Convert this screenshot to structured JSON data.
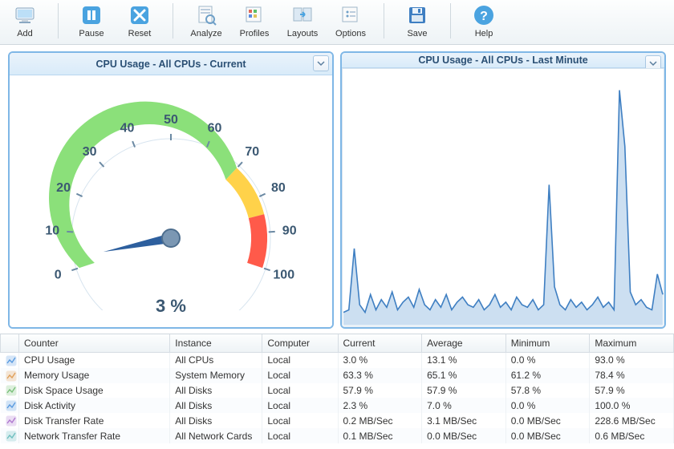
{
  "toolbar": {
    "add": "Add",
    "pause": "Pause",
    "reset": "Reset",
    "analyze": "Analyze",
    "profiles": "Profiles",
    "layouts": "Layouts",
    "options": "Options",
    "save": "Save",
    "help": "Help"
  },
  "panels": {
    "gauge": {
      "title": "CPU Usage - All CPUs - Current",
      "value_label": "3 %"
    },
    "chart": {
      "title": "CPU Usage - All CPUs - Last Minute"
    }
  },
  "chart_data": [
    {
      "type": "gauge",
      "title": "CPU Usage - All CPUs - Current",
      "value": 3,
      "min": 0,
      "max": 100,
      "ticks": [
        0,
        10,
        20,
        30,
        40,
        50,
        60,
        70,
        80,
        90,
        100
      ],
      "bands": [
        {
          "from": 0,
          "to": 70,
          "color": "#8be07a"
        },
        {
          "from": 70,
          "to": 85,
          "color": "#ffd24a"
        },
        {
          "from": 85,
          "to": 100,
          "color": "#ff5a4a"
        }
      ],
      "unit": "%"
    },
    {
      "type": "area",
      "title": "CPU Usage - All CPUs - Last Minute",
      "xlabel": "",
      "ylabel": "",
      "ylim": [
        0,
        100
      ],
      "x": [
        0,
        1,
        2,
        3,
        4,
        5,
        6,
        7,
        8,
        9,
        10,
        11,
        12,
        13,
        14,
        15,
        16,
        17,
        18,
        19,
        20,
        21,
        22,
        23,
        24,
        25,
        26,
        27,
        28,
        29,
        30,
        31,
        32,
        33,
        34,
        35,
        36,
        37,
        38,
        39,
        40,
        41,
        42,
        43,
        44,
        45,
        46,
        47,
        48,
        49,
        50,
        51,
        52,
        53,
        54,
        55,
        56,
        57,
        58,
        59
      ],
      "values": [
        5,
        6,
        30,
        8,
        5,
        12,
        6,
        10,
        7,
        13,
        6,
        9,
        11,
        7,
        14,
        8,
        6,
        10,
        7,
        12,
        6,
        9,
        11,
        8,
        7,
        10,
        6,
        8,
        12,
        7,
        9,
        6,
        11,
        8,
        7,
        10,
        6,
        8,
        55,
        15,
        8,
        6,
        10,
        7,
        9,
        6,
        8,
        11,
        7,
        9,
        6,
        92,
        70,
        13,
        8,
        10,
        7,
        6,
        20,
        12
      ]
    }
  ],
  "grid": {
    "headers": {
      "counter": "Counter",
      "instance": "Instance",
      "computer": "Computer",
      "current": "Current",
      "average": "Average",
      "minimum": "Minimum",
      "maximum": "Maximum"
    },
    "rows": [
      {
        "counter": "CPU Usage",
        "instance": "All CPUs",
        "computer": "Local",
        "current": "3.0 %",
        "average": "13.1 %",
        "minimum": "0.0 %",
        "maximum": "93.0 %"
      },
      {
        "counter": "Memory Usage",
        "instance": "System Memory",
        "computer": "Local",
        "current": "63.3 %",
        "average": "65.1 %",
        "minimum": "61.2 %",
        "maximum": "78.4 %"
      },
      {
        "counter": "Disk Space Usage",
        "instance": "All Disks",
        "computer": "Local",
        "current": "57.9 %",
        "average": "57.9 %",
        "minimum": "57.8 %",
        "maximum": "57.9 %"
      },
      {
        "counter": "Disk Activity",
        "instance": "All Disks",
        "computer": "Local",
        "current": "2.3 %",
        "average": "7.0 %",
        "minimum": "0.0 %",
        "maximum": "100.0 %"
      },
      {
        "counter": "Disk Transfer Rate",
        "instance": "All Disks",
        "computer": "Local",
        "current": "0.2 MB/Sec",
        "average": "3.1 MB/Sec",
        "minimum": "0.0 MB/Sec",
        "maximum": "228.6 MB/Sec"
      },
      {
        "counter": "Network Transfer Rate",
        "instance": "All Network Cards",
        "computer": "Local",
        "current": "0.1 MB/Sec",
        "average": "0.0 MB/Sec",
        "minimum": "0.0 MB/Sec",
        "maximum": "0.6 MB/Sec"
      }
    ]
  }
}
